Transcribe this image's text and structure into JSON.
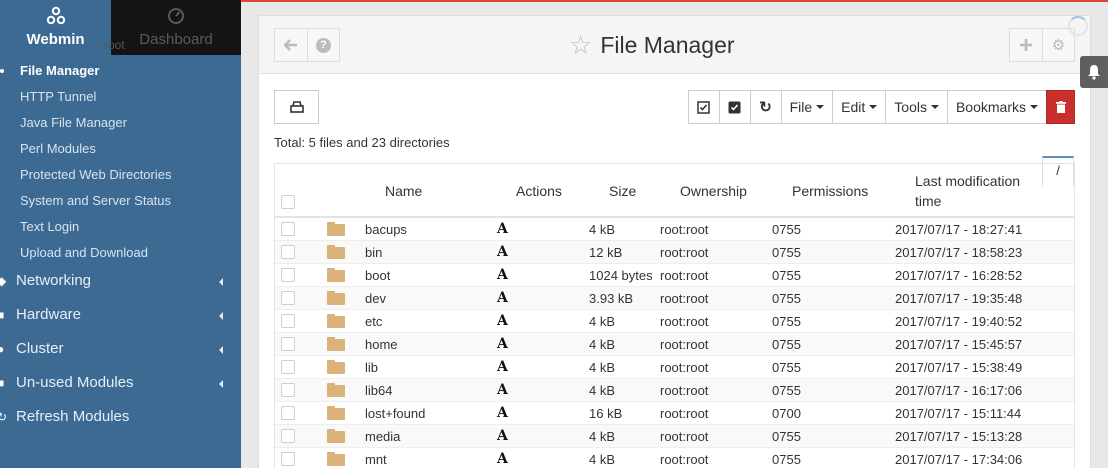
{
  "sidebar": {
    "brand": {
      "webmin_label": "Webmin",
      "dashboard_label": "Dashboard",
      "ghost_text": "root"
    },
    "sub_items": [
      {
        "label": "File Manager",
        "active": true
      },
      {
        "label": "HTTP Tunnel"
      },
      {
        "label": "Java File Manager"
      },
      {
        "label": "Perl Modules"
      },
      {
        "label": "Protected Web Directories"
      },
      {
        "label": "System and Server Status"
      },
      {
        "label": "Text Login"
      },
      {
        "label": "Upload and Download"
      }
    ],
    "categories": [
      {
        "label": "Networking",
        "icon": "network-icon"
      },
      {
        "label": "Hardware",
        "icon": "hardware-icon"
      },
      {
        "label": "Cluster",
        "icon": "cluster-icon"
      },
      {
        "label": "Un-used Modules",
        "icon": "puzzle-icon"
      },
      {
        "label": "Refresh Modules",
        "icon": "refresh-icon"
      }
    ]
  },
  "header": {
    "title": "File Manager"
  },
  "toolbar": {
    "file_label": "File",
    "edit_label": "Edit",
    "tools_label": "Tools",
    "bookmarks_label": "Bookmarks"
  },
  "summary": {
    "total": "Total: 5 files and 23 directories"
  },
  "path": {
    "current": "/"
  },
  "table": {
    "headers": {
      "name": "Name",
      "actions": "Actions",
      "size": "Size",
      "ownership": "Ownership",
      "permissions": "Permissions",
      "modified_line1": "Last modification",
      "modified_line2": "time"
    },
    "rows": [
      {
        "name": "bacups",
        "action": "A",
        "size": "4 kB",
        "owner": "root:root",
        "perm": "0755",
        "modified": "2017/07/17 - 18:27:41"
      },
      {
        "name": "bin",
        "action": "A",
        "size": "12 kB",
        "owner": "root:root",
        "perm": "0755",
        "modified": "2017/07/17 - 18:58:23"
      },
      {
        "name": "boot",
        "action": "A",
        "size": "1024 bytes",
        "owner": "root:root",
        "perm": "0755",
        "modified": "2017/07/17 - 16:28:52"
      },
      {
        "name": "dev",
        "action": "A",
        "size": "3.93 kB",
        "owner": "root:root",
        "perm": "0755",
        "modified": "2017/07/17 - 19:35:48"
      },
      {
        "name": "etc",
        "action": "A",
        "size": "4 kB",
        "owner": "root:root",
        "perm": "0755",
        "modified": "2017/07/17 - 19:40:52"
      },
      {
        "name": "home",
        "action": "A",
        "size": "4 kB",
        "owner": "root:root",
        "perm": "0755",
        "modified": "2017/07/17 - 15:45:57"
      },
      {
        "name": "lib",
        "action": "A",
        "size": "4 kB",
        "owner": "root:root",
        "perm": "0755",
        "modified": "2017/07/17 - 15:38:49"
      },
      {
        "name": "lib64",
        "action": "A",
        "size": "4 kB",
        "owner": "root:root",
        "perm": "0755",
        "modified": "2017/07/17 - 16:17:06"
      },
      {
        "name": "lost+found",
        "action": "A",
        "size": "16 kB",
        "owner": "root:root",
        "perm": "0700",
        "modified": "2017/07/17 - 15:11:44"
      },
      {
        "name": "media",
        "action": "A",
        "size": "4 kB",
        "owner": "root:root",
        "perm": "0755",
        "modified": "2017/07/17 - 15:13:28"
      },
      {
        "name": "mnt",
        "action": "A",
        "size": "4 kB",
        "owner": "root:root",
        "perm": "0755",
        "modified": "2017/07/17 - 17:34:06"
      }
    ]
  },
  "colors": {
    "sidebar": "#3c6a93",
    "accent": "#e0453b",
    "danger": "#c9302c",
    "folder": "#dcb27b"
  }
}
